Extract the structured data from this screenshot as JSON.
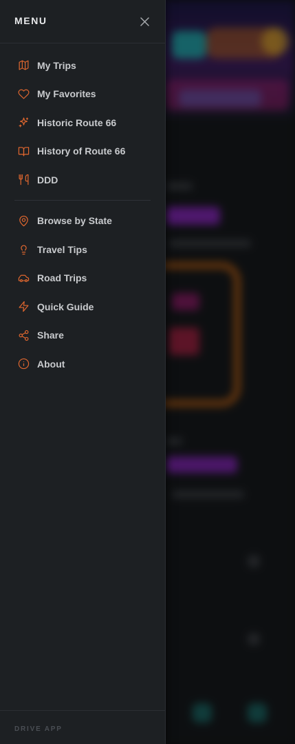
{
  "drawer": {
    "title": "MENU",
    "footer": "DRIVE APP",
    "accent_color": "#e0672f",
    "primary_items": [
      {
        "label": "My Trips",
        "icon": "map-icon"
      },
      {
        "label": "My Favorites",
        "icon": "heart-icon"
      },
      {
        "label": "Historic Route 66",
        "icon": "sparkles-icon"
      },
      {
        "label": "History of Route 66",
        "icon": "book-open-icon"
      },
      {
        "label": "DDD",
        "icon": "utensils-icon"
      }
    ],
    "secondary_items": [
      {
        "label": "Browse by State",
        "icon": "map-pin-icon"
      },
      {
        "label": "Travel Tips",
        "icon": "lightbulb-icon"
      },
      {
        "label": "Road Trips",
        "icon": "car-icon"
      },
      {
        "label": "Quick Guide",
        "icon": "zap-icon"
      },
      {
        "label": "Share",
        "icon": "share-icon"
      },
      {
        "label": "About",
        "icon": "info-icon"
      }
    ]
  }
}
